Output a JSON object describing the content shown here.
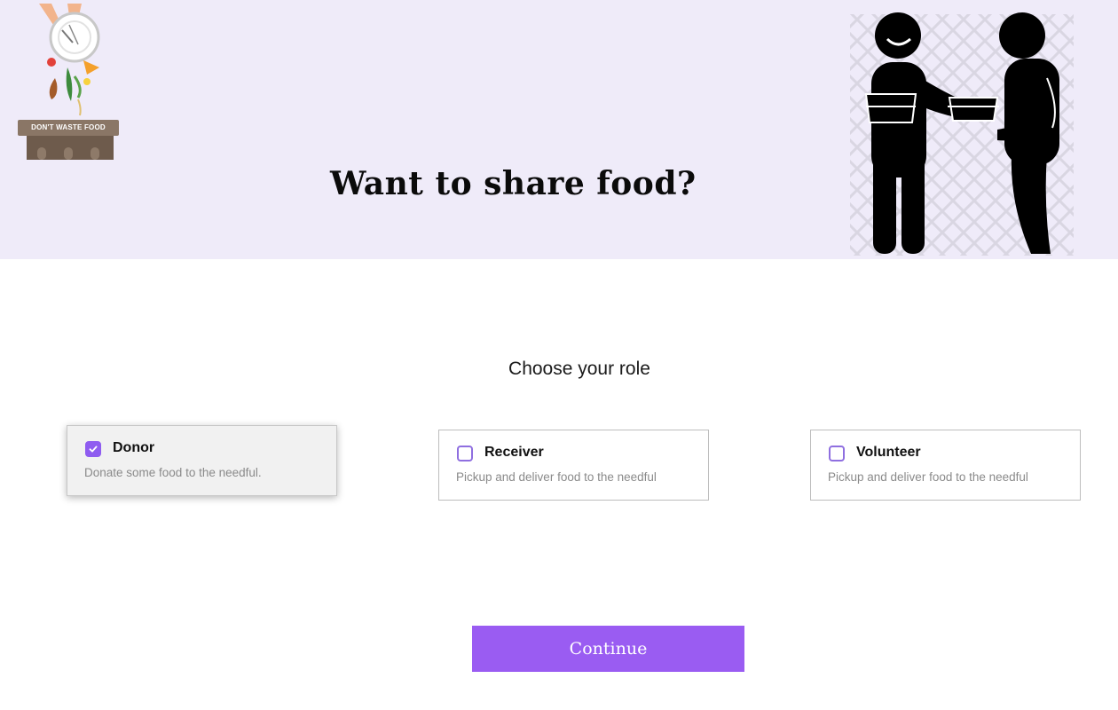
{
  "hero": {
    "logo_text": "DON'T WASTE FOOD",
    "title": "Want to share food?",
    "background": "#efebf9",
    "illustration_icon": "people-sharing-food-icon"
  },
  "role_section": {
    "heading": "Choose your role",
    "roles": [
      {
        "title": "Donor",
        "description": "Donate some food to the needful.",
        "checked": true
      },
      {
        "title": "Receiver",
        "description": "Pickup and deliver food to the needful",
        "checked": false
      },
      {
        "title": "Volunteer",
        "description": "Pickup and deliver food to the needful",
        "checked": false
      }
    ]
  },
  "actions": {
    "continue_label": "Continue"
  },
  "colors": {
    "accent": "#9a5cf2",
    "checkbox_border": "#8f6fe0",
    "hero_bg": "#efebf9"
  }
}
